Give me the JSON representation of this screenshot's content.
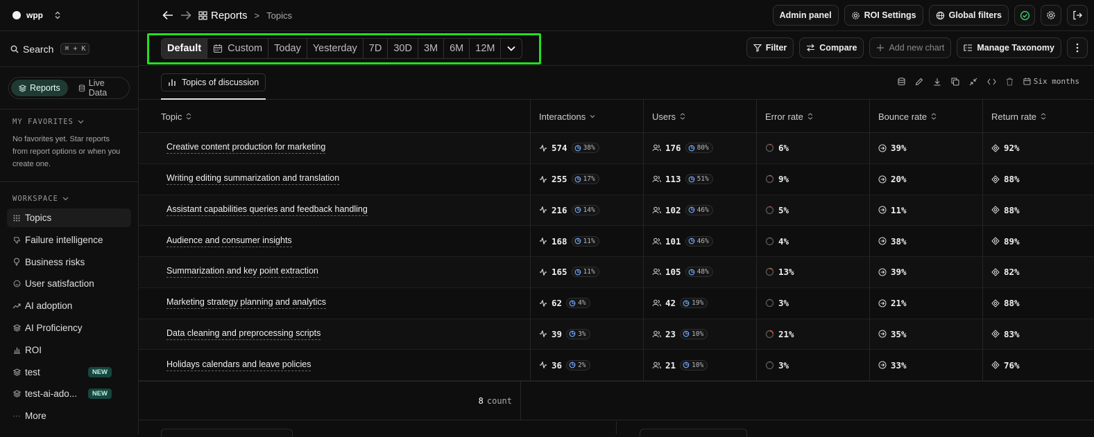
{
  "workspace": {
    "name": "wpp"
  },
  "sidebar": {
    "search": {
      "label": "Search",
      "shortcut": "⌘ + K"
    },
    "modes": [
      {
        "label": "Reports",
        "active": true
      },
      {
        "label": "Live Data",
        "active": false
      }
    ],
    "favorites": {
      "title": "MY FAVORITES",
      "empty_text": "No favorites yet. Star reports from report options or when you create one."
    },
    "workspace_title": "WORKSPACE",
    "items": [
      {
        "label": "Topics",
        "icon": "grid-icon",
        "active": true
      },
      {
        "label": "Failure intelligence",
        "icon": "thumbs-down-icon"
      },
      {
        "label": "Business risks",
        "icon": "lightbulb-icon"
      },
      {
        "label": "User satisfaction",
        "icon": "smile-icon"
      },
      {
        "label": "AI adoption",
        "icon": "trend-up-icon"
      },
      {
        "label": "AI Proficiency",
        "icon": "layers-icon"
      },
      {
        "label": "ROI",
        "icon": "bar-chart-icon"
      },
      {
        "label": "test",
        "icon": "layers-icon",
        "badge": "NEW"
      },
      {
        "label": "test-ai-ado...",
        "icon": "layers-icon",
        "badge": "NEW"
      },
      {
        "label": "More",
        "icon": "dots-icon"
      }
    ]
  },
  "topbar": {
    "crumb_main": "Reports",
    "crumb_sep": ">",
    "crumb_sub": "Topics",
    "admin_label": "Admin panel",
    "roi_label": "ROI Settings",
    "filters_label": "Global filters"
  },
  "toolbar": {
    "ranges": [
      "Default",
      "Custom",
      "Today",
      "Yesterday",
      "7D",
      "30D",
      "3M",
      "6M",
      "12M"
    ],
    "active_range": "Default",
    "filter_label": "Filter",
    "compare_label": "Compare",
    "add_chart_label": "Add new chart",
    "taxonomy_label": "Manage Taxonomy"
  },
  "chart_tab": {
    "label": "Topics of discussion",
    "period": "Six months"
  },
  "table": {
    "headers": [
      "Topic",
      "Interactions",
      "Users",
      "Error rate",
      "Bounce rate",
      "Return rate"
    ],
    "rows": [
      {
        "topic": "Creative content production for marketing",
        "interactions": "574",
        "int_pct": "38%",
        "users": "176",
        "users_pct": "80%",
        "error": "6%",
        "bounce": "39%",
        "return": "92%"
      },
      {
        "topic": "Writing editing summarization and translation",
        "interactions": "255",
        "int_pct": "17%",
        "users": "113",
        "users_pct": "51%",
        "error": "9%",
        "bounce": "20%",
        "return": "88%"
      },
      {
        "topic": "Assistant capabilities queries and feedback handling",
        "interactions": "216",
        "int_pct": "14%",
        "users": "102",
        "users_pct": "46%",
        "error": "5%",
        "bounce": "11%",
        "return": "88%"
      },
      {
        "topic": "Audience and consumer insights",
        "interactions": "168",
        "int_pct": "11%",
        "users": "101",
        "users_pct": "46%",
        "error": "4%",
        "bounce": "38%",
        "return": "89%"
      },
      {
        "topic": "Summarization and key point extraction",
        "interactions": "165",
        "int_pct": "11%",
        "users": "105",
        "users_pct": "48%",
        "error": "13%",
        "bounce": "39%",
        "return": "82%"
      },
      {
        "topic": "Marketing strategy planning and analytics",
        "interactions": "62",
        "int_pct": "4%",
        "users": "42",
        "users_pct": "19%",
        "error": "3%",
        "bounce": "21%",
        "return": "88%"
      },
      {
        "topic": "Data cleaning and preprocessing scripts",
        "interactions": "39",
        "int_pct": "3%",
        "users": "23",
        "users_pct": "10%",
        "error": "21%",
        "bounce": "35%",
        "return": "83%"
      },
      {
        "topic": "Holidays calendars and leave policies",
        "interactions": "36",
        "int_pct": "2%",
        "users": "21",
        "users_pct": "10%",
        "error": "3%",
        "bounce": "33%",
        "return": "76%"
      }
    ],
    "footer_count": "8",
    "footer_label": "count"
  },
  "colors": {
    "accent": "#22e01f",
    "error_ring": "#e8593c",
    "badge": "#16463f"
  }
}
